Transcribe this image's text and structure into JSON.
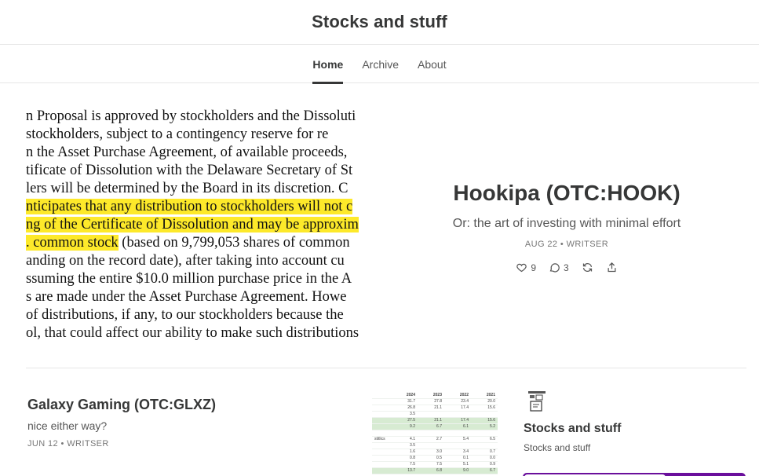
{
  "site": {
    "title": "Stocks and stuff"
  },
  "nav": {
    "tabs": [
      {
        "label": "Home"
      },
      {
        "label": "Archive"
      },
      {
        "label": "About"
      }
    ]
  },
  "featured": {
    "title": "Hookipa (OTC:HOOK)",
    "subtitle": "Or: the art of investing with minimal effort",
    "meta": "AUG 22 • WRITSER",
    "likes": "9",
    "comments": "3",
    "image_lines": [
      {
        "text": "n Proposal is approved by stockholders and the Dissoluti",
        "parts": []
      },
      {
        "text": " stockholders, subject to a contingency reserve for re",
        "parts": []
      },
      {
        "text": "n the Asset Purchase Agreement, of available proceeds, ",
        "parts": []
      },
      {
        "text": "tificate of Dissolution with the Delaware Secretary of St",
        "parts": []
      },
      {
        "text": "lers will be determined by the Board in its discretion. C",
        "parts": []
      },
      {
        "text": "",
        "parts": [
          {
            "t": "nticipates that any distribution to stockholders will not c",
            "hl": true
          }
        ]
      },
      {
        "text": "",
        "parts": [
          {
            "t": "ng of the Certificate of Dissolution and may be approxim",
            "hl": true
          }
        ]
      },
      {
        "text": "",
        "parts": [
          {
            "t": ". common stock",
            "hl": true
          },
          {
            "t": " (based on 9,799,053 shares of common ",
            "hl": false
          }
        ]
      },
      {
        "text": "anding on the record date), after taking into account cu",
        "parts": []
      },
      {
        "text": "ssuming the entire $10.0 million purchase price in the A",
        "parts": []
      },
      {
        "text": "s are made under the Asset Purchase Agreement. Howe",
        "parts": []
      },
      {
        "text": "of distributions, if any, to our stockholders because the",
        "parts": []
      },
      {
        "text": "ol, that could affect our ability to make such distributions",
        "parts": []
      }
    ]
  },
  "posts": [
    {
      "title": "Galaxy Gaming (OTC:GLXZ)",
      "subtitle": "nice either way?",
      "meta": "JUN 12 • WRITSER",
      "thumb_headers": [
        "",
        "2024",
        "2023",
        "2022",
        "2021"
      ],
      "thumb_rows": [
        {
          "cells": [
            "",
            "31.7",
            "27.8",
            "23.4",
            "20.0"
          ],
          "g": false
        },
        {
          "cells": [
            "",
            "26.8",
            "21.1",
            "17.4",
            "15.6"
          ],
          "g": false
        },
        {
          "cells": [
            "",
            "3.5",
            "",
            "",
            ""
          ],
          "g": false
        },
        {
          "cells": [
            "",
            "27.5",
            "21.1",
            "17.4",
            "15.6"
          ],
          "g": true
        },
        {
          "cells": [
            "",
            "9.2",
            "6.7",
            "6.1",
            "5.2"
          ],
          "g": true
        },
        {
          "cells": [
            "",
            "",
            "",
            "",
            ""
          ],
          "g": false
        },
        {
          "cells": [
            "stitlics",
            "4.1",
            "2.7",
            "5.4",
            "6.5"
          ],
          "g": false
        },
        {
          "cells": [
            "",
            "3.5",
            "",
            "",
            ""
          ],
          "g": false
        },
        {
          "cells": [
            "",
            "1.6",
            "3.0",
            "3.4",
            "0.7"
          ],
          "g": false
        },
        {
          "cells": [
            "",
            "0.8",
            "0.5",
            "0.1",
            "0.0"
          ],
          "g": false
        },
        {
          "cells": [
            "",
            "7.5",
            "7.5",
            "5.1",
            "0.9"
          ],
          "g": false
        },
        {
          "cells": [
            "",
            "13.7",
            "6.8",
            "9.0",
            "6.7"
          ],
          "g": true
        }
      ]
    }
  ],
  "sidebar": {
    "title": "Stocks and stuff",
    "description": "Stocks and stuff"
  },
  "icons": {
    "like": "heart-icon",
    "comment": "comment-icon",
    "restack": "restack-icon",
    "share": "share-icon",
    "logo": "publication-logo"
  },
  "colors": {
    "highlight": "#fde92a",
    "subscribe": "#6a0f9c"
  }
}
